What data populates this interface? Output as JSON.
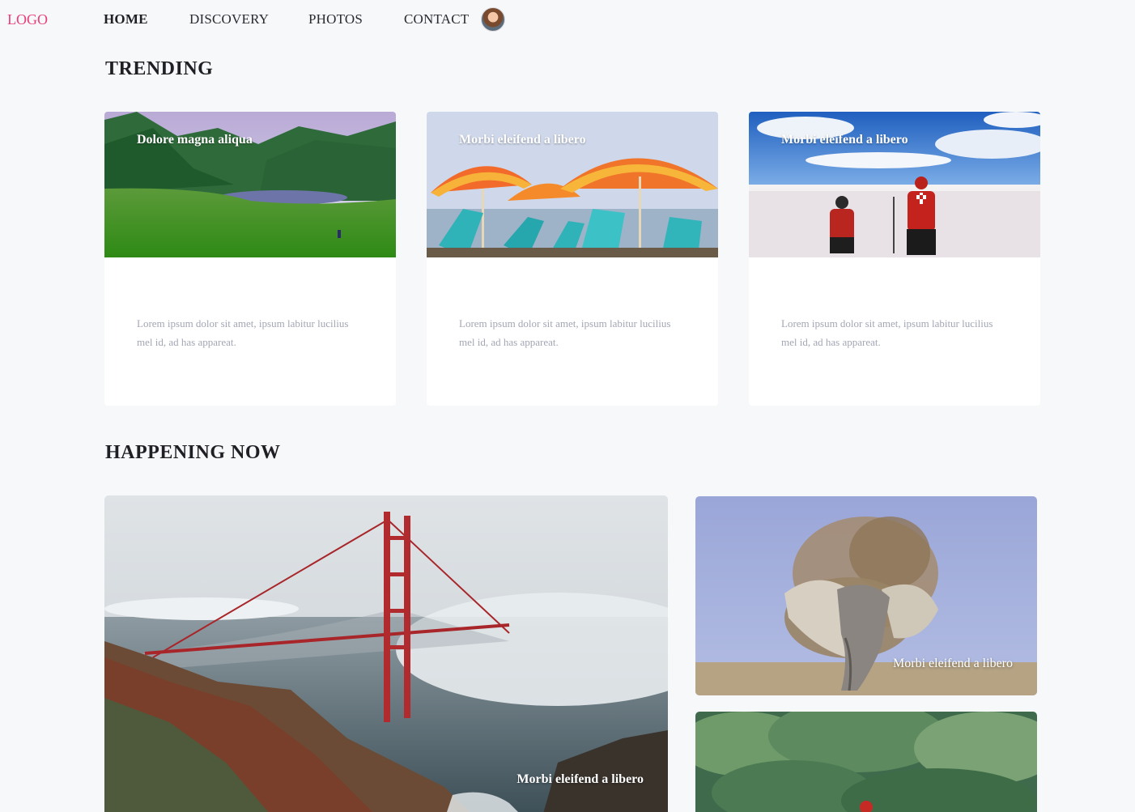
{
  "nav": {
    "logo": "LOGO",
    "items": [
      {
        "label": "HOME",
        "active": true
      },
      {
        "label": "DISCOVERY",
        "active": false
      },
      {
        "label": "PHOTOS",
        "active": false
      },
      {
        "label": "CONTACT",
        "active": false
      }
    ]
  },
  "trending": {
    "title": "TRENDING",
    "cards": [
      {
        "title": "Dolore magna aliqua",
        "text": "Lorem ipsum dolor sit amet, ipsum labitur lucilius mel id, ad has appareat."
      },
      {
        "title": "Morbi eleifend a libero",
        "text": "Lorem ipsum dolor sit amet, ipsum labitur lucilius mel id, ad has appareat."
      },
      {
        "title": "Morbi eleifend a libero",
        "text": "Lorem ipsum dolor sit amet, ipsum labitur lucilius mel id, ad has appareat."
      }
    ]
  },
  "happening": {
    "title": "HAPPENING NOW",
    "tiles": [
      {
        "caption": "Morbi eleifend a libero"
      },
      {
        "caption": "Morbi eleifend a libero"
      }
    ]
  },
  "colors": {
    "accent": "#e8407a",
    "background": "#f7f8fa",
    "muted_text": "#a3a6b4"
  }
}
